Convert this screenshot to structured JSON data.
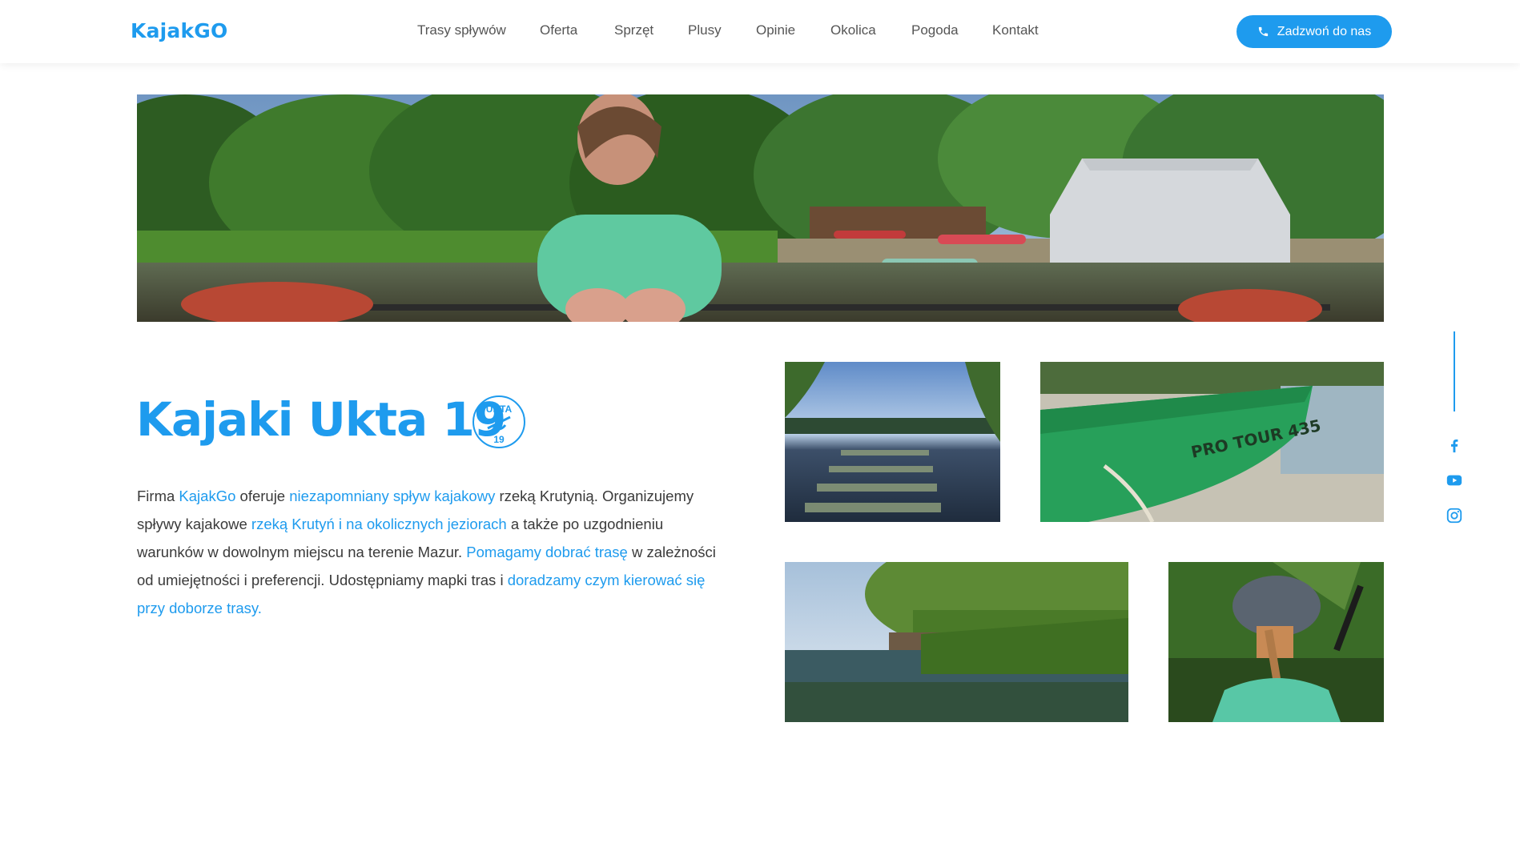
{
  "header": {
    "logo": "KajakGO",
    "nav": [
      {
        "label": "Trasy spływów"
      },
      {
        "label": "Oferta"
      },
      {
        "label": "Sprzęt"
      },
      {
        "label": "Plusy"
      },
      {
        "label": "Opinie"
      },
      {
        "label": "Okolica"
      },
      {
        "label": "Pogoda"
      },
      {
        "label": "Kontakt"
      }
    ],
    "call_button": {
      "label": "Zadzwoń do nas",
      "icon": "phone-icon"
    }
  },
  "main": {
    "title": "Kajaki Ukta 19",
    "badge_text": [
      "UKTA",
      "19"
    ],
    "paragraph": [
      {
        "text": "Firma ",
        "link": false
      },
      {
        "text": "KajakGo",
        "link": true
      },
      {
        "text": " oferuje ",
        "link": false
      },
      {
        "text": "niezapomniany spływ kajakowy",
        "link": true
      },
      {
        "text": " rzeką Krutynią. Organizujemy spływy kajakowe ",
        "link": false
      },
      {
        "text": "rzeką Krutyń i na okolicznych jeziorach",
        "link": true
      },
      {
        "text": " a także po uzgodnieniu warunków w dowolnym miejscu na terenie Mazur. ",
        "link": false
      },
      {
        "text": "Pomagamy dobrać trasę",
        "link": true
      },
      {
        "text": " w zależności od umiejętności i preferencji. Udostępniamy mapki tras i ",
        "link": false
      },
      {
        "text": "doradzamy czym kierować się przy doborze trasy.",
        "link": true
      }
    ],
    "gallery_text": {
      "kayak_print": "PRO TOUR 435"
    }
  },
  "social": [
    {
      "name": "facebook-icon"
    },
    {
      "name": "youtube-icon"
    },
    {
      "name": "instagram-icon"
    }
  ],
  "colors": {
    "accent": "#1e9bee",
    "text": "#3a3a3a",
    "nav_text": "#555555"
  }
}
